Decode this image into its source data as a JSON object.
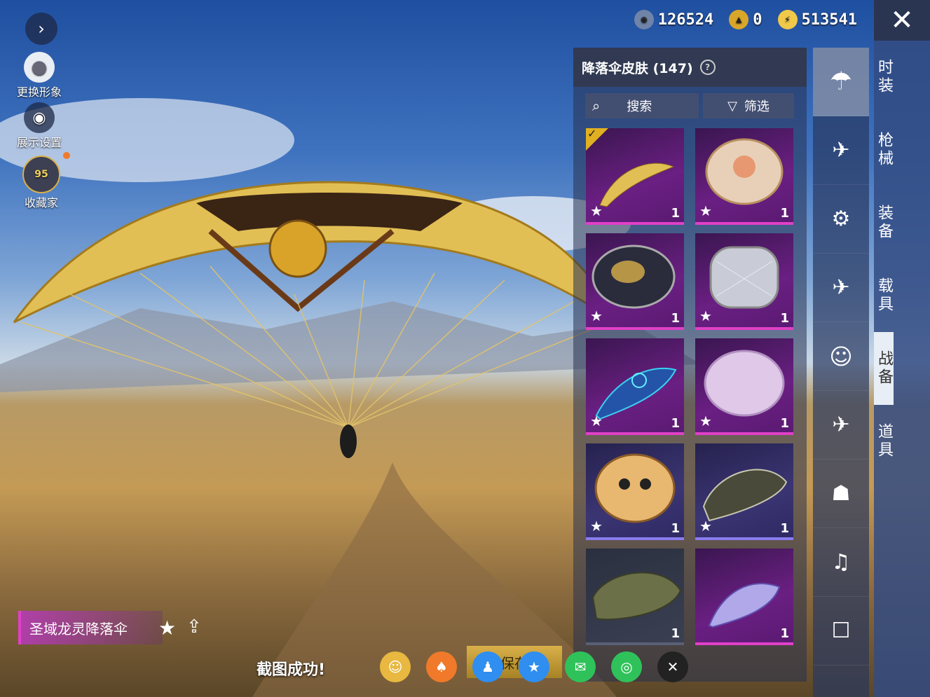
{
  "currency": [
    {
      "icon": "silver-coin-icon",
      "value": "126524"
    },
    {
      "icon": "gold-token-icon",
      "value": "0"
    },
    {
      "icon": "lightning-coin-icon",
      "value": "513541"
    }
  ],
  "left": {
    "change_avatar": "更换形象",
    "display_settings": "展示设置",
    "collector": "收藏家",
    "collector_level": "95"
  },
  "panel": {
    "title": "降落伞皮肤 (147)",
    "help": "?",
    "search_label": "搜索",
    "filter_label": "筛选"
  },
  "items": [
    {
      "count": "1"
    },
    {
      "count": "1"
    },
    {
      "count": "1"
    },
    {
      "count": "1"
    },
    {
      "count": "1"
    },
    {
      "count": "1"
    },
    {
      "count": "1"
    },
    {
      "count": "1"
    },
    {
      "count": "1"
    },
    {
      "count": "1"
    }
  ],
  "categories": [
    "时装",
    "枪械",
    "装备",
    "载具",
    "战备",
    "道具"
  ],
  "selected_name": "圣域龙灵降落伞",
  "toast": "截图成功!",
  "save_label": "保存",
  "colors": {
    "accent": "#e040c8",
    "gold": "#d9b04a"
  }
}
